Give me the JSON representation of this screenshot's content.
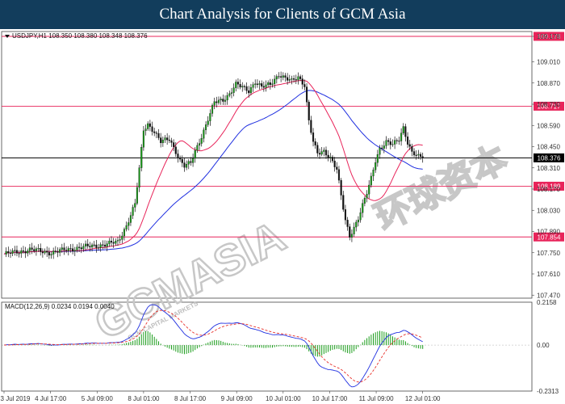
{
  "banner_title": "Chart Analysis for Clients of GCM Asia",
  "chart_data": {
    "type": "candlestick",
    "symbol_info": "USDJPY,H1  108.350 108.380 108.348 108.376",
    "ylim": [
      107.45,
      109.21
    ],
    "y_ticks": [
      "109.178",
      "109.010",
      "108.870",
      "108.730",
      "108.590",
      "108.450",
      "108.310",
      "108.170",
      "108.030",
      "107.890",
      "107.750",
      "107.610",
      "107.470"
    ],
    "x_ticks": [
      "3 Jul 2019",
      "4 Jul 17:00",
      "5 Jul 09:00",
      "8 Jul 01:00",
      "8 Jul 17:00",
      "9 Jul 09:00",
      "10 Jul 01:00",
      "10 Jul 17:00",
      "11 Jul 09:00",
      "12 Jul 01:00"
    ],
    "horizontal_levels": [
      {
        "value": 109.178,
        "label": "109.178",
        "color": "#e8245a"
      },
      {
        "value": 108.717,
        "label": "108.717",
        "color": "#e8245a"
      },
      {
        "value": 108.376,
        "label": "108.376",
        "color": "#000000"
      },
      {
        "value": 108.189,
        "label": "108.189",
        "color": "#e8245a"
      },
      {
        "value": 107.854,
        "label": "107.854",
        "color": "#e8245a"
      }
    ],
    "price_path": [
      [
        0,
        107.74
      ],
      [
        12,
        107.77
      ],
      [
        22,
        107.75
      ],
      [
        33,
        107.78
      ],
      [
        45,
        107.8
      ],
      [
        53,
        107.82
      ],
      [
        57,
        107.93
      ],
      [
        61,
        108.07
      ],
      [
        63,
        108.3
      ],
      [
        65,
        108.56
      ],
      [
        67,
        108.6
      ],
      [
        70,
        108.55
      ],
      [
        73,
        108.48
      ],
      [
        77,
        108.5
      ],
      [
        80,
        108.42
      ],
      [
        82,
        108.36
      ],
      [
        84,
        108.32
      ],
      [
        87,
        108.34
      ],
      [
        89,
        108.42
      ],
      [
        92,
        108.52
      ],
      [
        95,
        108.63
      ],
      [
        98,
        108.74
      ],
      [
        102,
        108.76
      ],
      [
        105,
        108.8
      ],
      [
        108,
        108.86
      ],
      [
        111,
        108.84
      ],
      [
        114,
        108.82
      ],
      [
        117,
        108.88
      ],
      [
        120,
        108.84
      ],
      [
        124,
        108.86
      ],
      [
        128,
        108.93
      ],
      [
        131,
        108.9
      ],
      [
        134,
        108.88
      ],
      [
        137,
        108.91
      ],
      [
        140,
        108.86
      ],
      [
        142,
        108.62
      ],
      [
        144,
        108.48
      ],
      [
        146,
        108.4
      ],
      [
        149,
        108.42
      ],
      [
        152,
        108.38
      ],
      [
        155,
        108.3
      ],
      [
        157,
        108.12
      ],
      [
        159,
        107.96
      ],
      [
        161,
        107.86
      ],
      [
        163,
        107.92
      ],
      [
        165,
        107.98
      ],
      [
        167,
        108.06
      ],
      [
        169,
        108.14
      ],
      [
        171,
        108.24
      ],
      [
        173,
        108.36
      ],
      [
        175,
        108.44
      ],
      [
        178,
        108.48
      ],
      [
        181,
        108.46
      ],
      [
        184,
        108.5
      ],
      [
        186,
        108.58
      ],
      [
        188,
        108.48
      ],
      [
        190,
        108.41
      ],
      [
        193,
        108.38
      ],
      [
        195,
        108.376
      ]
    ],
    "ma_fast_color": "#e8245a",
    "ma_slow_color": "#2030e0",
    "macd": {
      "label": "MACD(12,26,9)  0.0234  0.0194  0.0040",
      "ylim": [
        -0.2313,
        0.2158
      ],
      "y_ticks": [
        "0.2158",
        "0.00",
        "-0.2313"
      ],
      "hist_color": "#1a9c1a",
      "signal_color": "#e8302a",
      "macd_color": "#2030e0"
    }
  },
  "watermark": {
    "brand": "GCMASIA",
    "sub": "GCM CAPITAL MARKETS",
    "cn": "环球资本"
  }
}
